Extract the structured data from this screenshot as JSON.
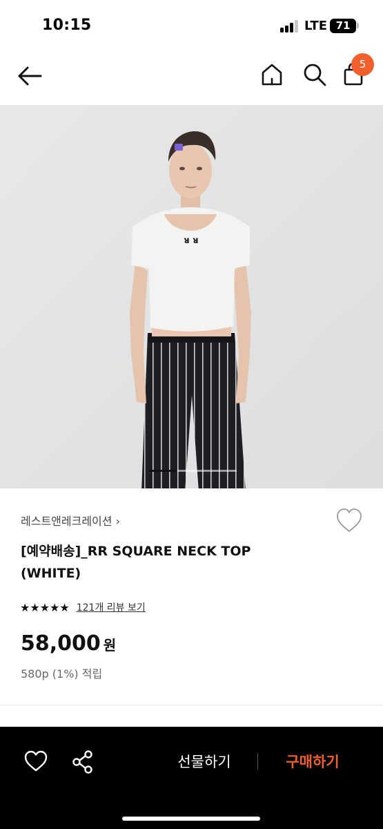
{
  "status_bar": {
    "time": "10:15",
    "network": "LTE",
    "battery": "71"
  },
  "header": {
    "cart_count": "5"
  },
  "product": {
    "brand": "레스트앤레크레이션",
    "brand_chevron": "›",
    "title": "[예약배송]_RR SQUARE NECK TOP (WHITE)",
    "stars": "★★★★★",
    "rating": 5,
    "review_link": "121개 리뷰 보기",
    "price": "58,000",
    "currency": "원",
    "points": "580p (1%) 적립",
    "image_logo_text": "ᴚ ᴚ",
    "image_indicator_progress": 0.33
  },
  "bottom_bar": {
    "gift_label": "선물하기",
    "buy_label": "구매하기"
  },
  "colors": {
    "accent": "#f0602f",
    "bottom_bar_bg": "#000000",
    "image_bg": "#e4e5e6"
  },
  "icons": [
    "back-arrow-icon",
    "home-icon",
    "search-icon",
    "shopping-bag-icon",
    "heart-icon",
    "share-icon"
  ]
}
